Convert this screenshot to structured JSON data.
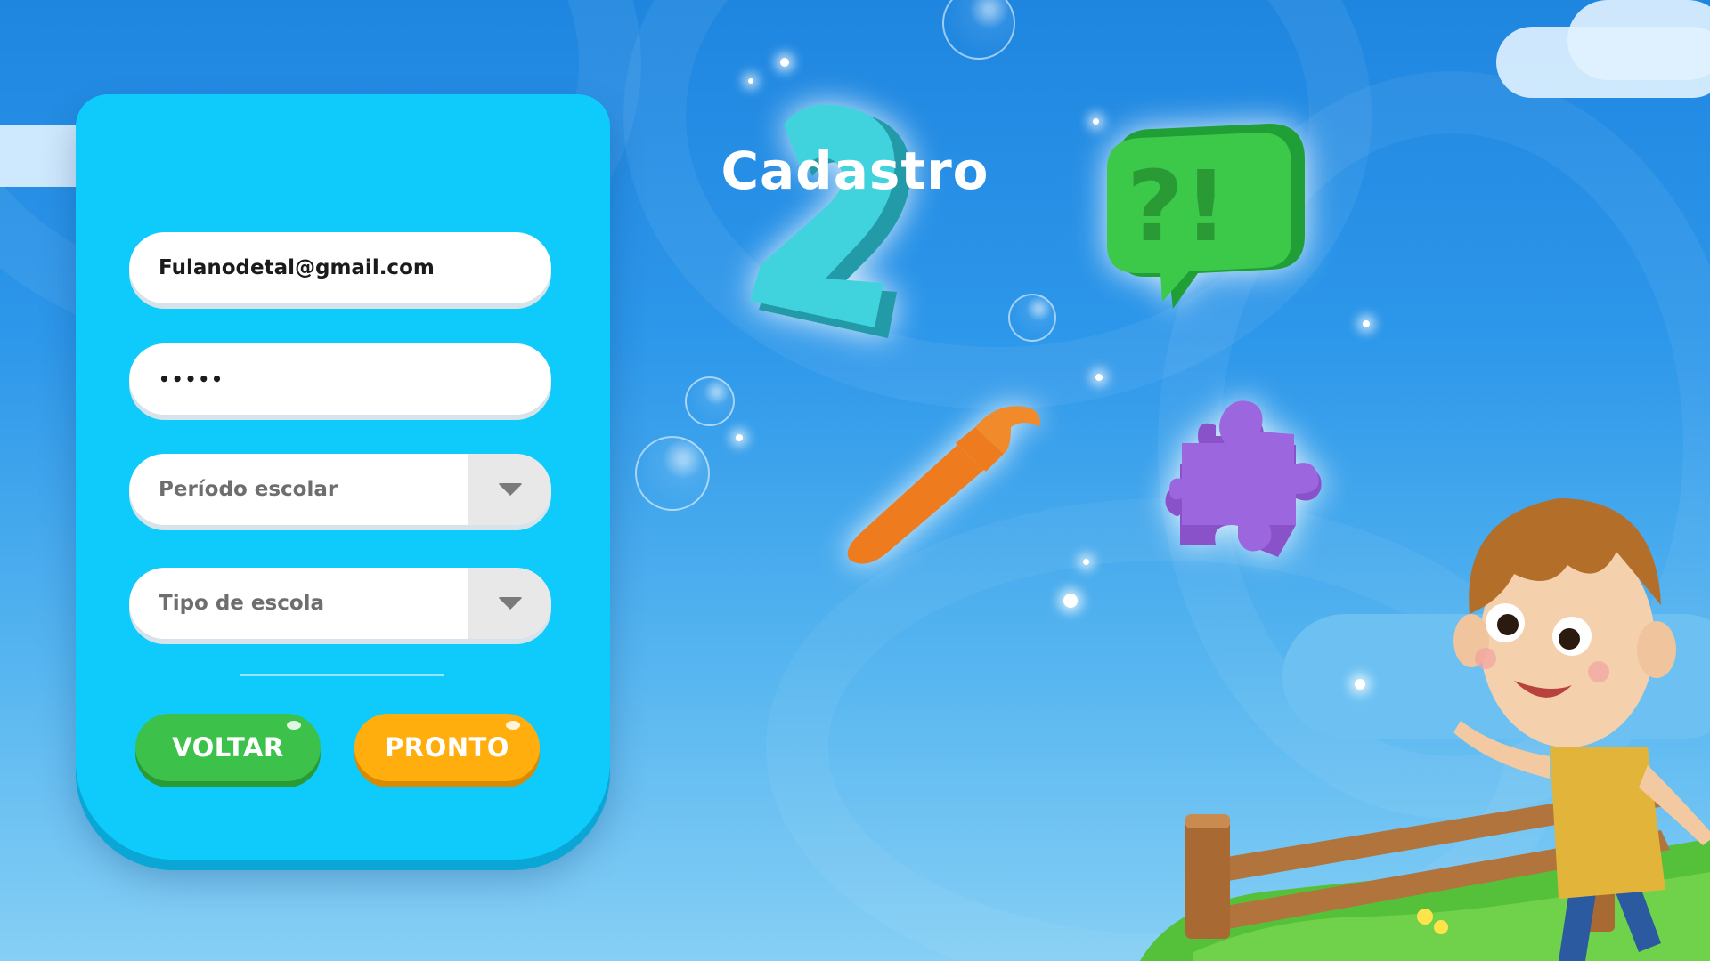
{
  "registration": {
    "title": "Cadastro",
    "email_value": "Fulanodetal@gmail.com",
    "password_value": "•••••",
    "school_period": {
      "placeholder": "Período escolar",
      "arrow_icon": "caret-down-icon"
    },
    "school_type": {
      "placeholder": "Tipo de escola",
      "arrow_icon": "caret-down-icon"
    },
    "back_button": "VOLTAR",
    "done_button": "PRONTO"
  },
  "theme": {
    "card_color": "#0ecbfb",
    "back_button_color": "#3cc24a",
    "done_button_color": "#ffae0d",
    "sky_top": "#1f86e0",
    "sky_bottom": "#86cff5"
  },
  "decorations": {
    "number_icon_text": "2",
    "speech_bubble_text": "?!",
    "icons": [
      "number-two-icon",
      "speech-bubble-icon",
      "paintbrush-icon",
      "puzzle-piece-icon",
      "boy-character",
      "wooden-fence",
      "grass-hill"
    ]
  }
}
